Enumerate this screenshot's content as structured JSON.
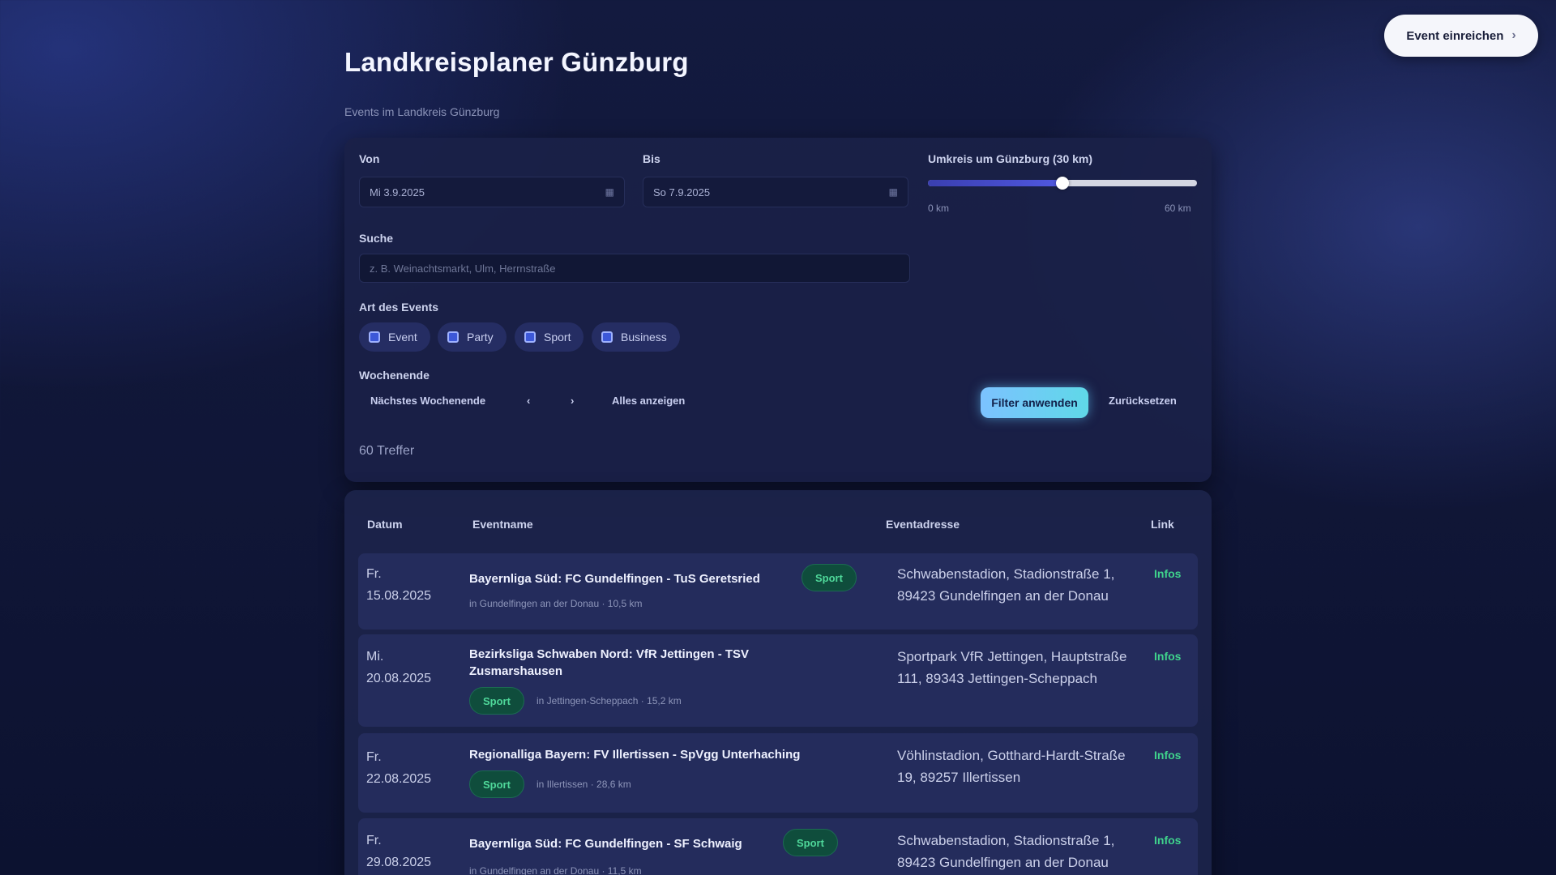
{
  "header": {
    "submit_button": "Event einreichen",
    "title": "Landkreisplaner Günzburg",
    "subtitle": "Events im Landkreis Günzburg"
  },
  "filters": {
    "from_label": "Von",
    "from_value": "Mi 3.9.2025",
    "to_label": "Bis",
    "to_value": "So 7.9.2025",
    "radius_label": "Umkreis um Günzburg (30 km)",
    "radius_value_fraction": 0.5,
    "radius_min": "0 km",
    "radius_max": "60 km",
    "search_label": "Suche",
    "search_placeholder": "z. B. Weinachtsmarkt, Ulm, Herrnstraße",
    "type_label": "Art des Events",
    "types": [
      {
        "label": "Event",
        "checked": true
      },
      {
        "label": "Party",
        "checked": true
      },
      {
        "label": "Sport",
        "checked": true
      },
      {
        "label": "Business",
        "checked": true
      }
    ],
    "weekend_label": "Wochenende",
    "next_weekend": "Nächstes Wochenende",
    "prev": "‹",
    "next": "›",
    "show_all": "Alles anzeigen",
    "apply": "Filter anwenden",
    "reset": "Zurücksetzen",
    "results": "60 Treffer"
  },
  "table": {
    "columns": [
      "Datum",
      "Eventname",
      "Eventadresse",
      "Link"
    ],
    "rows": [
      {
        "date_line1": "Fr.",
        "date_line2": "15.08.2025",
        "name": "Bayernliga Süd: FC Gundelfingen - TuS Geretsried",
        "badge": "Sport",
        "meta": "in Gundelfingen an der Donau · 10,5 km",
        "address": "Schwabenstadion, Stadionstraße 1, 89423 Gundelfingen an der Donau",
        "link": "Infos"
      },
      {
        "date_line1": "Mi.",
        "date_line2": "20.08.2025",
        "name": "Bezirksliga Schwaben Nord: VfR Jettingen - TSV Zusmarshausen",
        "badge": "Sport",
        "meta": "in Jettingen-Scheppach · 15,2 km",
        "address": "Sportpark VfR Jettingen, Hauptstraße 111, 89343 Jettingen-Scheppach",
        "link": "Infos"
      },
      {
        "date_line1": "Fr.",
        "date_line2": "22.08.2025",
        "name": "Regionalliga Bayern: FV Illertissen - SpVgg Unterhaching",
        "badge": "Sport",
        "meta": "in Illertissen · 28,6 km",
        "address": "Vöhlinstadion, Gotthard-Hardt-Straße 19, 89257 Illertissen",
        "link": "Infos"
      },
      {
        "date_line1": "Fr.",
        "date_line2": "29.08.2025",
        "name": "Bayernliga Süd: FC Gundelfingen - SF Schwaig",
        "badge": "Sport",
        "meta": "in Gundelfingen an der Donau · 11,5 km",
        "address": "Schwabenstadion, Stadionstraße 1, 89423 Gundelfingen an der Donau",
        "link": "Infos"
      }
    ]
  }
}
